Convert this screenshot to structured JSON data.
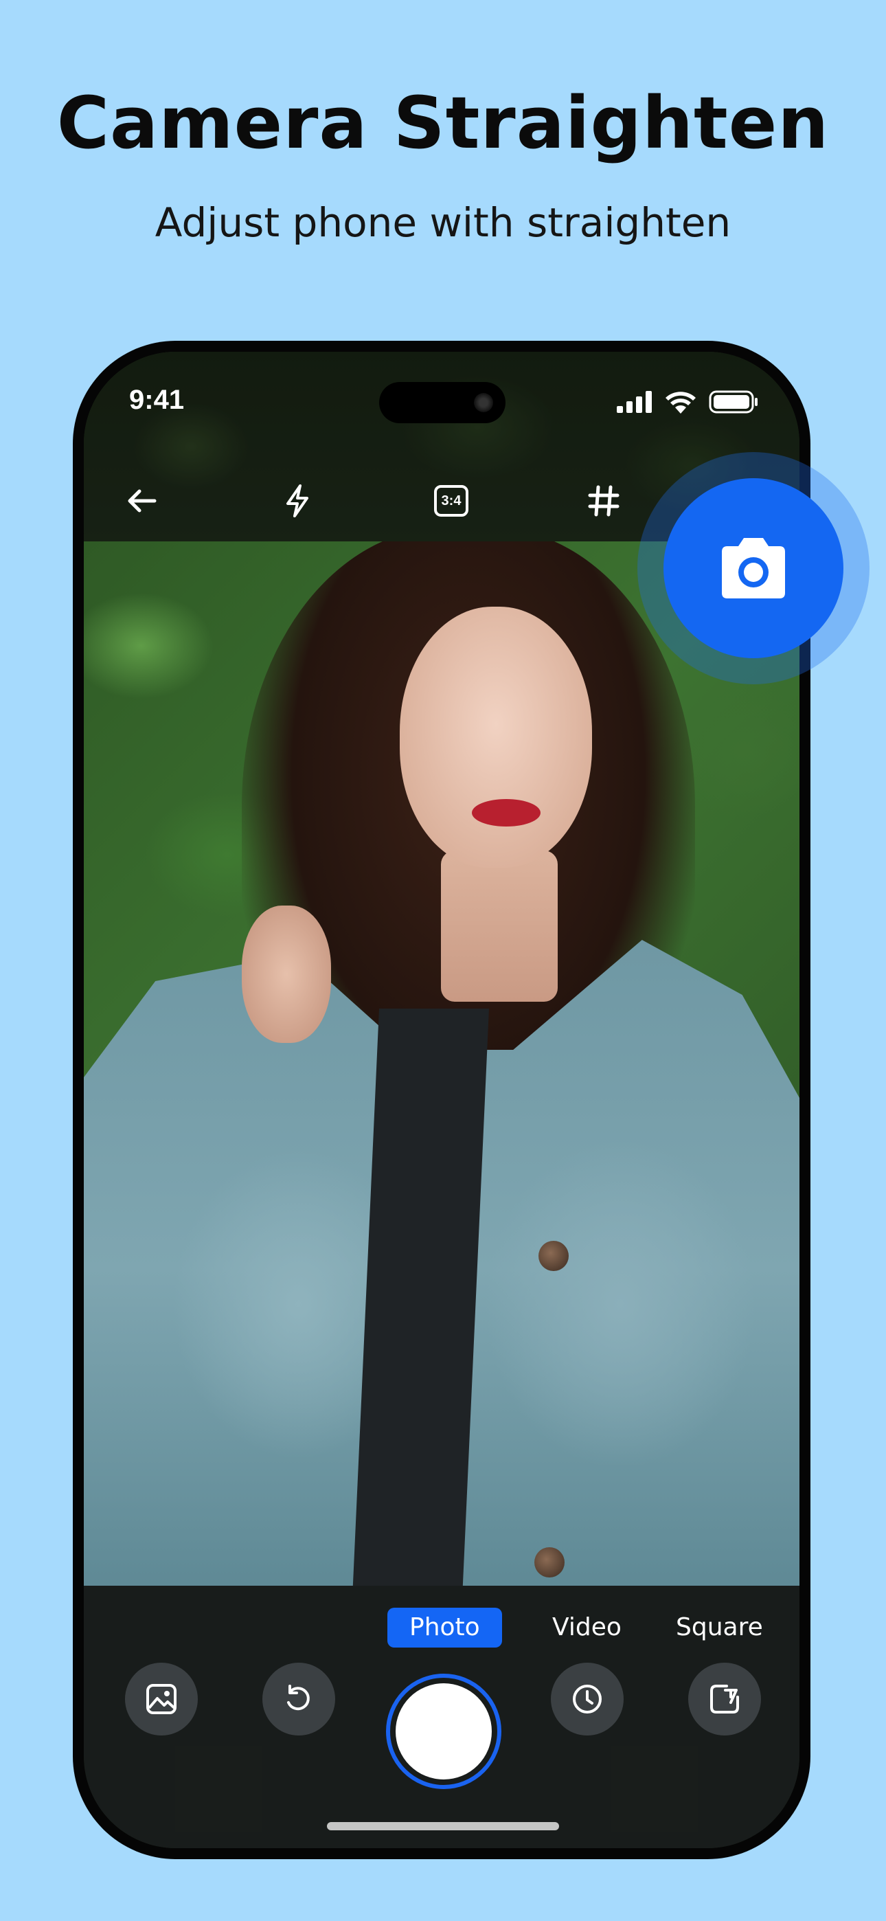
{
  "headline": "Camera Straighten",
  "subheadline": "Adjust phone with straighten",
  "status_bar": {
    "time": "9:41",
    "icons": [
      "signal-icon",
      "wifi-icon",
      "battery-icon"
    ]
  },
  "toolbar": {
    "icons": [
      "back-arrow-icon",
      "flash-icon",
      "aspect-ratio-icon",
      "grid-icon"
    ],
    "aspect_ratio_label": "3:4"
  },
  "floating_action": {
    "icon": "camera-icon",
    "color": "#1467f2"
  },
  "modes": {
    "items": [
      {
        "label": "Photo",
        "active": true
      },
      {
        "label": "Video",
        "active": false
      },
      {
        "label": "Square",
        "active": false
      }
    ]
  },
  "bottom_controls": [
    "gallery-icon",
    "rotate-icon",
    "shutter-button",
    "timer-icon",
    "straighten-icon"
  ],
  "colors": {
    "background": "#a6dafd",
    "accent": "#1466f5"
  }
}
